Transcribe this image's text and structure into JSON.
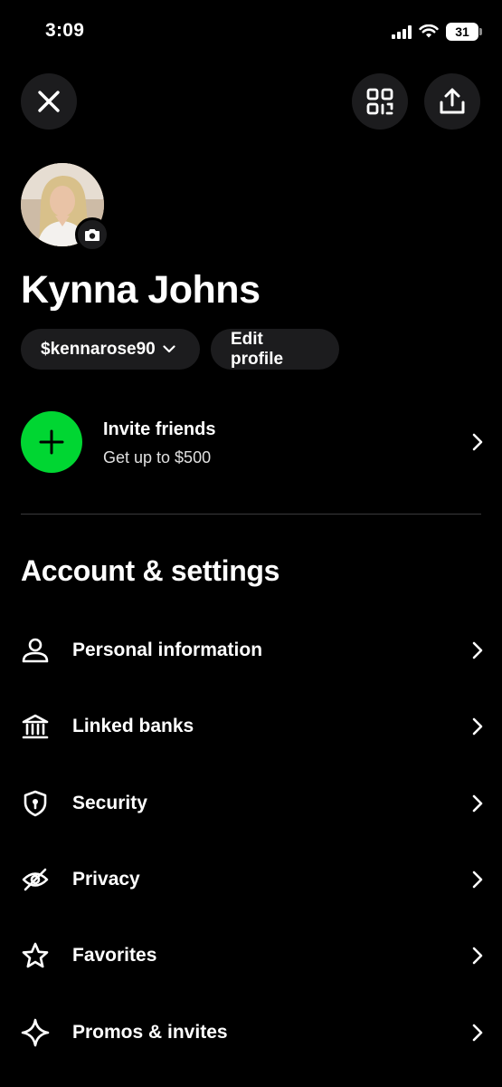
{
  "status_bar": {
    "time": "3:09",
    "battery": "31"
  },
  "header": {
    "close_icon": "close-icon",
    "qr_icon": "qr-scan-icon",
    "share_icon": "share-upload-icon"
  },
  "profile": {
    "name": "Kynna Johns",
    "cashtag": "$kennarose90",
    "edit_label": "Edit profile"
  },
  "invite": {
    "title": "Invite friends",
    "subtitle": "Get up to $500",
    "accent_color": "#00D632"
  },
  "settings": {
    "section_title": "Account & settings",
    "items": [
      {
        "label": "Personal information",
        "icon": "person-icon"
      },
      {
        "label": "Linked banks",
        "icon": "bank-icon"
      },
      {
        "label": "Security",
        "icon": "shield-icon"
      },
      {
        "label": "Privacy",
        "icon": "eye-off-icon"
      },
      {
        "label": "Favorites",
        "icon": "star-icon"
      },
      {
        "label": "Promos & invites",
        "icon": "sparkle-icon"
      }
    ]
  }
}
